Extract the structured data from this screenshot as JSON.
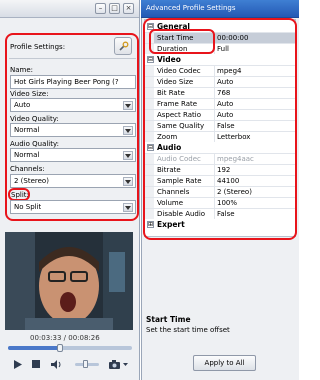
{
  "left_window": {
    "buttons": {
      "minimize": "–",
      "maximize": "□",
      "close": "×"
    },
    "profile_settings_label": "Profile Settings:",
    "fields": {
      "name_label": "Name:",
      "name_value": "Hot Girls Playing Beer Pong  (?",
      "video_size_label": "Video Size:",
      "video_size_value": "Auto",
      "video_quality_label": "Video Quality:",
      "video_quality_value": "Normal",
      "audio_quality_label": "Audio Quality:",
      "audio_quality_value": "Normal",
      "channels_label": "Channels:",
      "channels_value": "2 (Stereo)",
      "split_label": "Split:",
      "split_value": "No Split"
    },
    "player": {
      "time_display": "00:03:33 / 00:08:26",
      "playback_progress": 0.42
    }
  },
  "right_window": {
    "title": "Advanced Profile Settings",
    "categories": [
      {
        "name": "General",
        "expander": "⊟",
        "rows": [
          {
            "key": "Start Time",
            "value": "00:00:00"
          },
          {
            "key": "Duration",
            "value": "Full"
          }
        ]
      },
      {
        "name": "Video",
        "expander": "⊟",
        "rows": [
          {
            "key": "Video Codec",
            "value": "mpeg4"
          },
          {
            "key": "Video Size",
            "value": "Auto"
          },
          {
            "key": "Bit Rate",
            "value": "768"
          },
          {
            "key": "Frame Rate",
            "value": "Auto"
          },
          {
            "key": "Aspect Ratio",
            "value": "Auto"
          },
          {
            "key": "Same Quality",
            "value": "False"
          },
          {
            "key": "Zoom",
            "value": "Letterbox"
          }
        ]
      },
      {
        "name": "Audio",
        "expander": "⊟",
        "rows": [
          {
            "key": "Audio Codec",
            "value": "mpeg4aac"
          },
          {
            "key": "Bitrate",
            "value": "192"
          },
          {
            "key": "Sample Rate",
            "value": "44100"
          },
          {
            "key": "Channels",
            "value": "2 (Stereo)"
          },
          {
            "key": "Volume",
            "value": "100%"
          },
          {
            "key": "Disable Audio",
            "value": "False"
          }
        ]
      },
      {
        "name": "Expert",
        "expander": "⊞",
        "rows": []
      }
    ],
    "description": {
      "title": "Start Time",
      "text": "Set the start time offset"
    },
    "apply_button_label": "Apply to All"
  },
  "colors": {
    "highlight": "#e8141b",
    "title_blue": "#2459b4",
    "seek_fill": "#4a78c9"
  }
}
